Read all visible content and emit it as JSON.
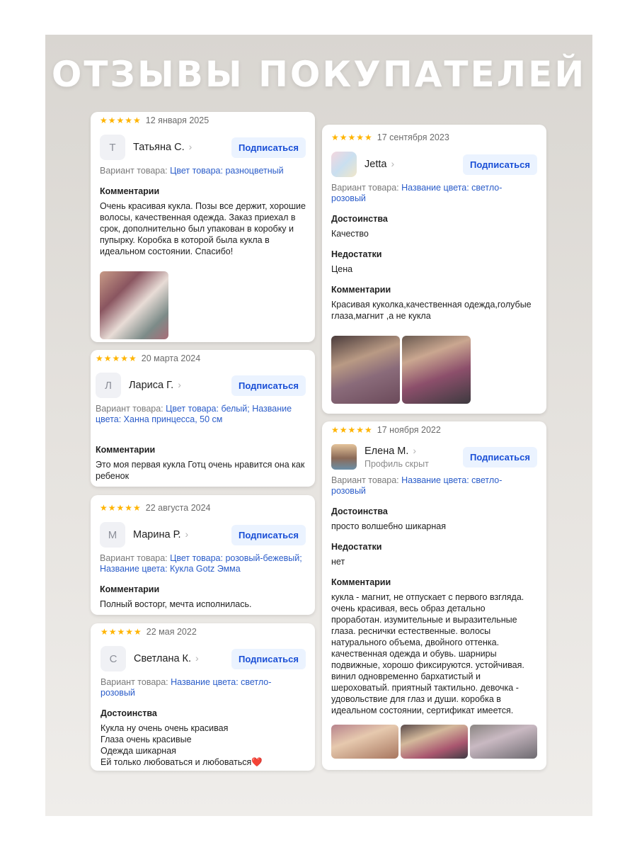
{
  "page_title": "ОТЗЫВЫ ПОКУПАТЕЛЕЙ",
  "stars": "★★★★★",
  "subscribe_label": "Подписаться",
  "variant_prefix": "Вариант товара: ",
  "colors": {
    "star": "#ffb400",
    "link": "#2a5cc9",
    "button_bg": "#ebf3ff",
    "button_text": "#1a4fd6"
  },
  "reviews": [
    {
      "date": "12 января 2025",
      "avatar_letter": "Т",
      "author": "Татьяна С.",
      "variant": "Цвет товара: разноцветный",
      "comments_title": "Комментарии",
      "comments": "Очень красивая кукла. Позы все держит, хорошие волосы, качественная одежда. Заказ приехал в срок, дополнительно был упакован в коробку и пупырку. Коробка в которой была кукла в идеальном состоянии. Спасибо!"
    },
    {
      "date": "20 марта 2024",
      "avatar_letter": "Л",
      "author": "Лариса Г.",
      "variant": "Цвет товара: белый; Название цвета: Ханна принцесса, 50 см",
      "comments_title": "Комментарии",
      "comments": "Это моя первая кукла Готц очень нравится она как ребенок"
    },
    {
      "date": "22 августа 2024",
      "avatar_letter": "М",
      "author": "Марина Р.",
      "variant": "Цвет товара: розовый-бежевый; Название цвета: Кукла Gotz Эмма",
      "comments_title": "Комментарии",
      "comments": "Полный восторг, мечта исполнилась."
    },
    {
      "date": "22 мая 2022",
      "avatar_letter": "С",
      "author": "Светлана К.",
      "variant": "Название цвета: светло-розовый",
      "pros_title": "Достоинства",
      "pros": "Кукла ну очень очень красивая\nГлаза очень красивые\nОдежда шикарная\nЕй только любоваться и любоваться❤️"
    },
    {
      "date": "17 сентября 2023",
      "author": "Jetta",
      "variant": "Название цвета: светло-розовый",
      "pros_title": "Достоинства",
      "pros": "Качество",
      "cons_title": "Недостатки",
      "cons": "Цена",
      "comments_title": "Комментарии",
      "comments": "Красивая куколка,качественная одежда,голубые глаза,магнит ,а не кукла"
    },
    {
      "date": "17 ноября 2022",
      "author": "Елена М.",
      "author_sub": "Профиль скрыт",
      "variant": "Название цвета: светло-розовый",
      "pros_title": "Достоинства",
      "pros": "просто волшебно шикарная",
      "cons_title": "Недостатки",
      "cons": "нет",
      "comments_title": "Комментарии",
      "comments": "кукла - магнит, не отпускает с первого взгляда. очень красивая, весь образ детально проработан. изумительные и выразительные глаза. реснички естественные. волосы натурального объема, двойного оттенка. качественная одежда и обувь. шарниры подвижные, хорошо фиксируются. устойчивая. винил одновременно бархатистый и шероховатый. приятный тактильно. девочка - удовольствие для глаз и души. коробка в идеальном состоянии, сертификат имеется."
    }
  ]
}
